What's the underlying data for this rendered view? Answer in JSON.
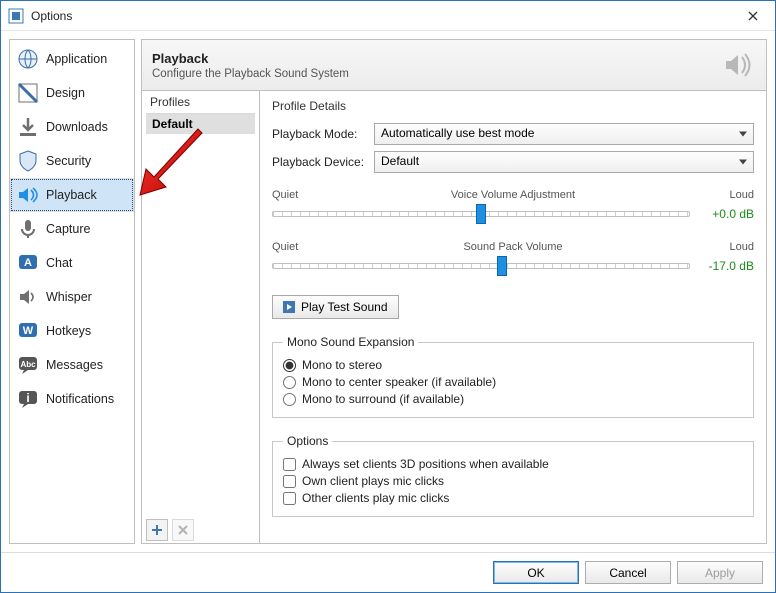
{
  "window": {
    "title": "Options"
  },
  "sidebar": {
    "items": [
      {
        "label": "Application",
        "icon": "globe"
      },
      {
        "label": "Design",
        "icon": "design"
      },
      {
        "label": "Downloads",
        "icon": "download"
      },
      {
        "label": "Security",
        "icon": "shield"
      },
      {
        "label": "Playback",
        "icon": "speaker",
        "selected": true
      },
      {
        "label": "Capture",
        "icon": "mic"
      },
      {
        "label": "Chat",
        "icon": "chat-a"
      },
      {
        "label": "Whisper",
        "icon": "whisper"
      },
      {
        "label": "Hotkeys",
        "icon": "hotkey-w"
      },
      {
        "label": "Messages",
        "icon": "messages"
      },
      {
        "label": "Notifications",
        "icon": "notify"
      }
    ]
  },
  "header": {
    "title": "Playback",
    "subtitle": "Configure the Playback Sound System"
  },
  "profiles": {
    "title": "Profiles",
    "items": [
      "Default"
    ],
    "add_tip": "+",
    "del_tip": "✕"
  },
  "details": {
    "title": "Profile Details",
    "mode_label": "Playback Mode:",
    "mode_value": "Automatically use best mode",
    "device_label": "Playback Device:",
    "device_value": "Default",
    "slider1": {
      "left": "Quiet",
      "center": "Voice Volume Adjustment",
      "right": "Loud",
      "db": "+0.0 dB",
      "percent": 50
    },
    "slider2": {
      "left": "Quiet",
      "center": "Sound Pack Volume",
      "right": "Loud",
      "db": "-17.0 dB",
      "percent": 55
    },
    "play_test": "Play Test Sound",
    "mono": {
      "legend": "Mono Sound Expansion",
      "opts": [
        "Mono to stereo",
        "Mono to center speaker (if available)",
        "Mono to surround (if available)"
      ],
      "selected": 0
    },
    "options": {
      "legend": "Options",
      "checks": [
        {
          "label": "Always set clients 3D positions when available",
          "checked": false
        },
        {
          "label": "Own client plays mic clicks",
          "checked": false
        },
        {
          "label": "Other clients play mic clicks",
          "checked": false
        }
      ]
    }
  },
  "footer": {
    "ok": "OK",
    "cancel": "Cancel",
    "apply": "Apply"
  }
}
